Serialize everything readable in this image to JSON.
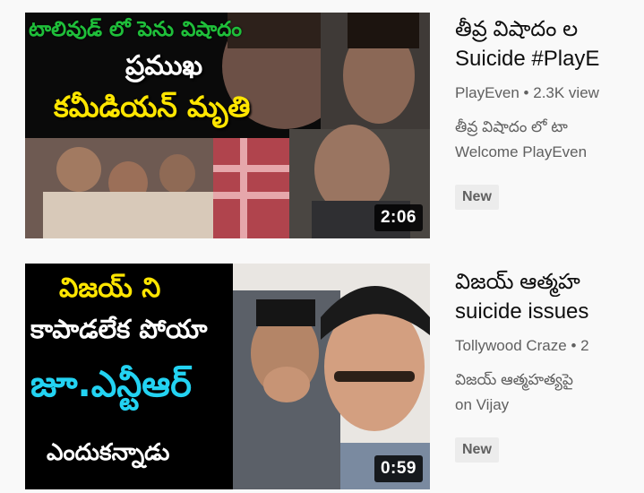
{
  "videos": [
    {
      "title_line1": "తీవ్ర విషాదం ల",
      "title_line2": "Suicide #PlayE",
      "channel": "PlayEven",
      "views": "2.3K view",
      "desc_line1": "తీవ్ర విషాదం లో టా",
      "desc_line2": "Welcome PlayEven",
      "badge": "New",
      "duration": "2:06",
      "thumb_text": [
        "టాలివుడ్ లో పెను విషాదం",
        "ప్రముఖ",
        "కమీడియన్ మృతి"
      ]
    },
    {
      "title_line1": "విజయ్ ఆత్మహ",
      "title_line2": "suicide issues",
      "channel": "Tollywood Craze",
      "views": "2",
      "desc_line1": "విజయ్ ఆత్మహత్యపై",
      "desc_line2": "on Vijay",
      "badge": "New",
      "duration": "0:59",
      "thumb_text": [
        "విజయ్ ని",
        "కాపాడలేక పోయా",
        "జూ.ఎన్టీఆర్",
        "ఎందుకన్నాడు"
      ]
    }
  ],
  "colors": {
    "yellow_text": "#ffe600",
    "green_text": "#1fbf3a",
    "cyan_text": "#23d3f2",
    "black_panel": "#000000"
  }
}
